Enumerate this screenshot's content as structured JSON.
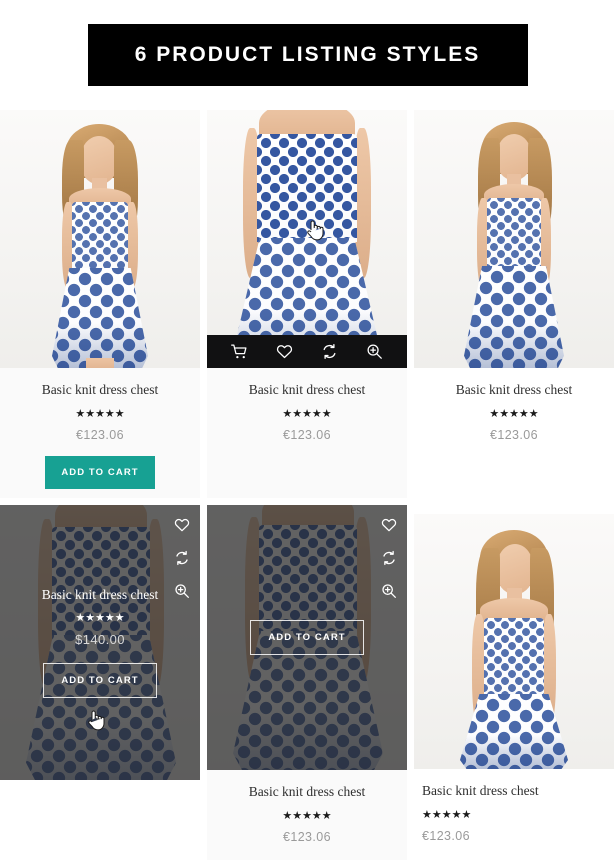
{
  "banner": {
    "title": "6 PRODUCT LISTING STYLES"
  },
  "icons": {
    "cart": "cart-icon",
    "wishlist": "heart-icon",
    "compare": "compare-icon",
    "quickview": "zoom-in-icon",
    "cursor": "pointer-hand-cursor"
  },
  "colors": {
    "accent_teal": "#17a193",
    "banner_bg": "#000000",
    "overlay": "rgba(38,38,38,0.72)",
    "price_text": "#9a9a9a",
    "title_text": "#2f2f2f",
    "card_shaded_bg": "#fafafa"
  },
  "products": [
    {
      "id": "style-1",
      "title": "Basic knit dress chest",
      "stars": "★★★★★",
      "rating": 5,
      "price": "€123.06",
      "add_to_cart_label": "ADD TO CART",
      "style": "visible-button",
      "align": "center",
      "background": "shaded"
    },
    {
      "id": "style-2",
      "title": "Basic knit dress chest",
      "stars": "★★★★★",
      "rating": 5,
      "price": "€123.06",
      "style": "hover-icon-bar",
      "align": "center",
      "background": "shaded",
      "hover_icons": [
        "cart-icon",
        "heart-icon",
        "compare-icon",
        "zoom-in-icon"
      ]
    },
    {
      "id": "style-3",
      "title": "Basic knit dress chest",
      "stars": "★★★★★",
      "rating": 5,
      "price": "€123.06",
      "style": "plain",
      "align": "center",
      "background": "plain"
    },
    {
      "id": "style-4",
      "title": "Basic knit dress chest",
      "stars": "★★★★★",
      "rating": 5,
      "price": "$140.00",
      "add_to_cart_label": "ADD TO CART",
      "style": "full-dark-overlay",
      "align": "center",
      "side_icons": [
        "heart-icon",
        "compare-icon",
        "zoom-in-icon"
      ]
    },
    {
      "id": "style-5",
      "title": "Basic knit dress chest",
      "stars": "★★★★★",
      "rating": 5,
      "price": "€123.06",
      "add_to_cart_label": "ADD TO CART",
      "style": "overlay-button-only",
      "align": "center",
      "side_icons": [
        "heart-icon",
        "compare-icon",
        "zoom-in-icon"
      ]
    },
    {
      "id": "style-6",
      "title": "Basic knit dress chest",
      "stars": "★★★★★",
      "rating": 5,
      "price": "€123.06",
      "style": "left-aligned",
      "align": "left",
      "background": "plain"
    }
  ]
}
